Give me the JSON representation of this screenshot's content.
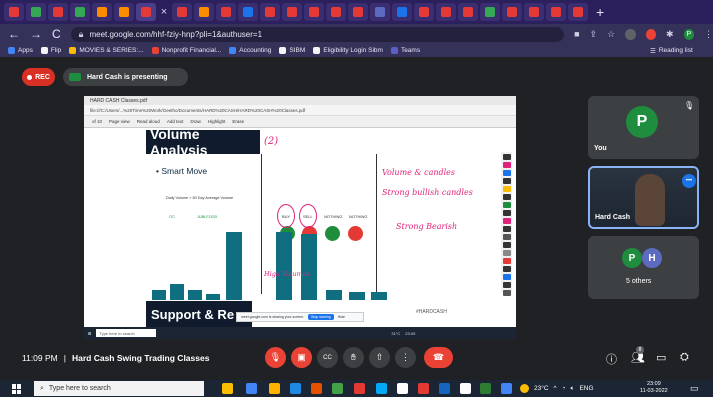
{
  "browser": {
    "tab_favicon_colors": [
      "#e53935",
      "#34a853",
      "#e53935",
      "#34a853",
      "#fb8c00",
      "#fb8c00",
      "#e53935",
      "#e53935",
      "#fb8c00",
      "#e53935",
      "#1a73e8",
      "#e53935",
      "#e53935",
      "#e53935",
      "#e53935",
      "#e53935",
      "#5c6bc0",
      "#1a73e8",
      "#e53935",
      "#e53935",
      "#e53935",
      "#34a853",
      "#e53935",
      "#e53935",
      "#e53935",
      "#e53935"
    ],
    "new_tab": "+",
    "url": "meet.google.com/hhf-fziy-hnp?pli=1&authuser=1",
    "bookmarks": [
      {
        "label": "Apps",
        "color": "#4285f4"
      },
      {
        "label": "Flip",
        "color": "#f5f5f5"
      },
      {
        "label": "MOVIES & SERIES:...",
        "color": "#fbbc04"
      },
      {
        "label": "Nonprofit Financial...",
        "color": "#ea4335"
      },
      {
        "label": "Accounting",
        "color": "#4285f4"
      },
      {
        "label": "SIBM",
        "color": "#f5f5f5"
      },
      {
        "label": "Eligibility Login Sibm",
        "color": "#f5f5f5"
      },
      {
        "label": "Teams",
        "color": "#5b5fc7"
      }
    ],
    "reading_list": "Reading list",
    "profile_initial": "P"
  },
  "meet": {
    "rec_label": "REC",
    "presenting_label": "Hard Cash is presenting",
    "time": "11:09 PM",
    "separator": "|",
    "meeting_name": "Hard Cash Swing Trading Classes",
    "participant_count": "8",
    "tiles": {
      "you": {
        "name": "You",
        "initial": "P",
        "color": "#1e8e3e"
      },
      "presenter": {
        "name": "Hard Cash"
      },
      "others": {
        "label": "5 others",
        "initials": [
          "P",
          "H"
        ],
        "colors": [
          "#1e8e3e",
          "#5c6bc0"
        ]
      }
    },
    "controls": {
      "mic_off": "mic-off-icon",
      "cam_off": "cam-off-icon",
      "cc": "CC",
      "hand": "hand-icon",
      "present": "present-icon",
      "more": "⋮",
      "end": "end-call-icon"
    }
  },
  "shared_screen": {
    "pdf_tab": "HARD CASH Classes.pdf",
    "pdf_url": "file:///C:/Users/...%20Time%20Work/Geetho/Documents/HARD%20CASH/HARD%20CASH%20Classes.pdf",
    "page_indicator": "of 10",
    "pdf_tools": [
      "Page view",
      "Read aloud",
      "Add text",
      "Draw",
      "Highlight",
      "Erase"
    ],
    "slide": {
      "title": "Volume Analysis",
      "bullet": "Smart Move",
      "formula": "Daily Volume > 50 Day Average Volume",
      "labels_left": [
        "ITC",
        "JUBLFOOD"
      ],
      "headers": [
        "BUY",
        "SELL",
        "NOTHING",
        "NOTHING"
      ],
      "circle_colors": [
        "#1e8e3e",
        "#e53935",
        "#1e8e3e",
        "#e53935"
      ],
      "bar_values": [
        5,
        8,
        5,
        3,
        34,
        34,
        33,
        5,
        4,
        4
      ],
      "watermark": "#HARDCASH",
      "footer_title": "Support & Re",
      "annotations": [
        "Volume & candles",
        "Strong bullish candles",
        "Strong Bearish",
        "High Volumes",
        "(2)"
      ]
    },
    "share_banner": {
      "text": "meet.google.com is sharing your screen.",
      "stop": "Stop sharing",
      "hide": "Hide"
    },
    "inner_taskbar": {
      "search": "Type here to search",
      "temp": "31°C",
      "time": "23:09",
      "date": "11-03-2022"
    }
  },
  "taskbar": {
    "search_placeholder": "Type here to search",
    "app_colors": [
      "#fbbc04",
      "#4285f4",
      "#ffb300",
      "#1e88e5",
      "#e65100",
      "#43a047",
      "#e53935",
      "#03a9f4",
      "#fff",
      "#e53935",
      "#1565c0",
      "#ffffff",
      "#2e7d32",
      "#4285f4"
    ],
    "temperature": "23°C",
    "language": "ENG",
    "time": "23:09",
    "date": "11-03-2022"
  }
}
